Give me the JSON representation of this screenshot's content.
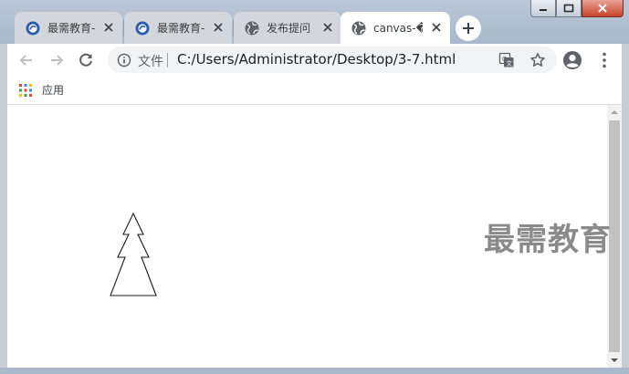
{
  "tabs": [
    {
      "title": "最需教育-",
      "favicon": "circle-logo-icon",
      "state": "inactive"
    },
    {
      "title": "最需教育-",
      "favicon": "circle-logo-icon",
      "state": "inactive"
    },
    {
      "title": "发布提问",
      "favicon": "globe-icon",
      "state": "inactive"
    },
    {
      "title": "canvas-�",
      "favicon": "globe-icon",
      "state": "active"
    }
  ],
  "toolbar": {
    "scheme_label": "文件",
    "url": "C:/Users/Administrator/Desktop/3-7.html"
  },
  "bookmarks": {
    "apps_label": "应用"
  },
  "watermark": {
    "text": "最需教育"
  },
  "colors": {
    "frame": "#a9b8ca",
    "close_button": "#c7432b",
    "tab_active": "#ffffff",
    "tab_inactive": "#d3d7dd",
    "omnibox": "#f1f3f4"
  }
}
